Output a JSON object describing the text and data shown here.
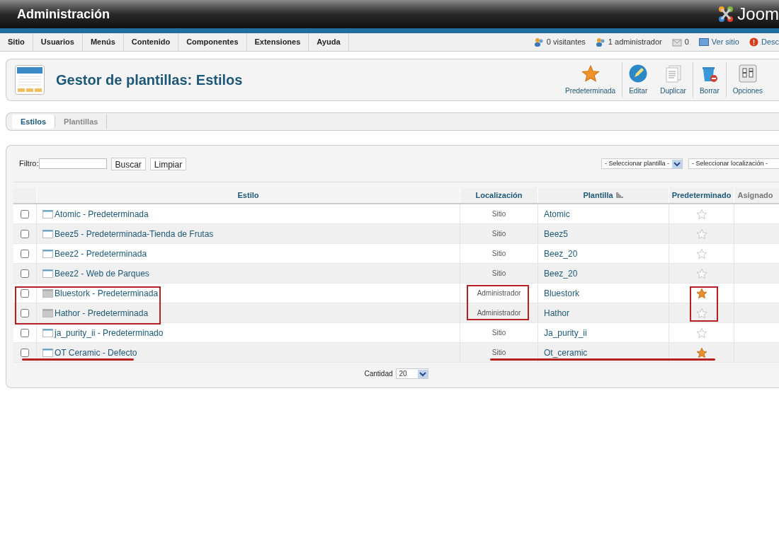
{
  "header": {
    "title": "Administración",
    "logo_text": "Joom"
  },
  "menu": [
    "Sitio",
    "Usuarios",
    "Menús",
    "Contenido",
    "Componentes",
    "Extensiones",
    "Ayuda"
  ],
  "status": [
    {
      "kind": "visitors",
      "text": "0 visitantes"
    },
    {
      "kind": "admins",
      "text": "1 administrador"
    },
    {
      "kind": "messages",
      "text": "0"
    },
    {
      "kind": "site",
      "text": "Ver sitio"
    },
    {
      "kind": "logout",
      "text": "Desc"
    }
  ],
  "page_title": "Gestor de plantillas: Estilos",
  "toolbar": [
    {
      "kind": "star",
      "label": "Predeterminada"
    },
    {
      "kind": "edit",
      "label": "Editar"
    },
    {
      "kind": "copy",
      "label": "Duplicar"
    },
    {
      "kind": "trash",
      "label": "Borrar"
    },
    {
      "kind": "options",
      "label": "Opciones"
    }
  ],
  "tabs": [
    {
      "label": "Estilos",
      "selected": true
    },
    {
      "label": "Plantillas",
      "selected": false
    }
  ],
  "filter": {
    "label": "Filtro:",
    "search_button": "Buscar",
    "clear_button": "Limpiar",
    "template_select": "- Seleccionar plantilla -",
    "location_select": "- Seleccionar localización -"
  },
  "table": {
    "columns": [
      "Estilo",
      "Localización",
      "Plantilla",
      "Predeterminado",
      "Asignado"
    ],
    "rows": [
      {
        "kind": "site",
        "checked": false,
        "style": "Atomic - Predeterminada",
        "location": "Sitio",
        "template": "Atomic",
        "default": false,
        "boxed": false,
        "underlined": false
      },
      {
        "kind": "site",
        "checked": false,
        "style": "Beez5 - Predeterminada-Tienda de Frutas",
        "location": "Sitio",
        "template": "Beez5",
        "default": false,
        "boxed": false,
        "underlined": false
      },
      {
        "kind": "site",
        "checked": false,
        "style": "Beez2 - Predeterminada",
        "location": "Sitio",
        "template": "Beez_20",
        "default": false,
        "boxed": false,
        "underlined": false
      },
      {
        "kind": "site",
        "checked": false,
        "style": "Beez2 - Web de Parques",
        "location": "Sitio",
        "template": "Beez_20",
        "default": false,
        "boxed": false,
        "underlined": false
      },
      {
        "kind": "admin",
        "checked": false,
        "style": "Bluestork - Predeterminada",
        "location": "Administrador",
        "template": "Bluestork",
        "default": true,
        "boxed": true,
        "underlined": false
      },
      {
        "kind": "admin",
        "checked": false,
        "style": "Hathor - Predeterminada",
        "location": "Administrador",
        "template": "Hathor",
        "default": false,
        "boxed": true,
        "underlined": false
      },
      {
        "kind": "site",
        "checked": false,
        "style": "ja_purity_ii - Predeterminado",
        "location": "Sitio",
        "template": "Ja_purity_ii",
        "default": false,
        "boxed": false,
        "underlined": false
      },
      {
        "kind": "site",
        "checked": false,
        "style": "OT Ceramic - Defecto",
        "location": "Sitio",
        "template": "Ot_ceramic",
        "default": true,
        "boxed": false,
        "underlined": true
      }
    ]
  },
  "pagination": {
    "label": "Cantidad",
    "value": "20"
  }
}
